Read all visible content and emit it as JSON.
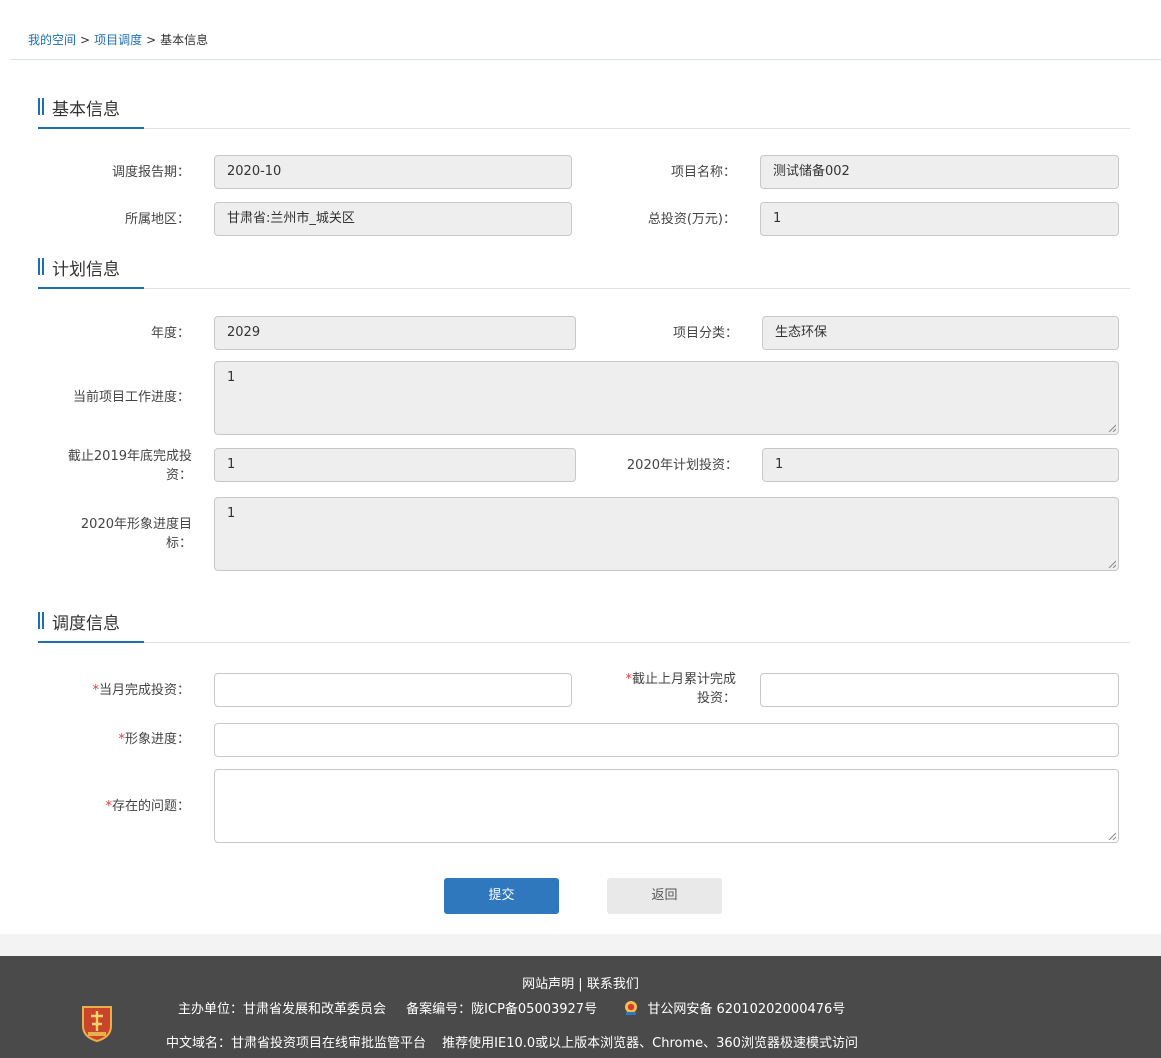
{
  "breadcrumb": {
    "items": [
      "我的空间",
      "项目调度",
      "基本信息"
    ],
    "sep": ">"
  },
  "sections": {
    "basic": "基本信息",
    "plan": "计划信息",
    "dispatch": "调度信息"
  },
  "basic": {
    "report_period": {
      "label": "调度报告期：",
      "value": "2020-10"
    },
    "project_name": {
      "label": "项目名称：",
      "value": "测试储备002"
    },
    "region": {
      "label": "所属地区：",
      "value": "甘肃省:兰州市_城关区"
    },
    "total_investment": {
      "label": "总投资(万元)：",
      "value": "1"
    }
  },
  "plan": {
    "year": {
      "label": "年度：",
      "value": "2029"
    },
    "category": {
      "label": "项目分类：",
      "value": "生态环保"
    },
    "progress": {
      "label": "当前项目工作进度：",
      "value": "1"
    },
    "completed_2019": {
      "label_line1": "截止2019年底完成投",
      "label_line2": "资：",
      "value": "1"
    },
    "planned_2020": {
      "label": "2020年计划投资：",
      "value": "1"
    },
    "target_2020": {
      "label_line1": "2020年形象进度目",
      "label_line2": "标：",
      "value": "1"
    }
  },
  "dispatch": {
    "required_mark": "*",
    "monthly_investment": {
      "label": "当月完成投资：",
      "value": ""
    },
    "cumulative_investment": {
      "label_line1": "截止上月累计完成",
      "label_line2": "投资：",
      "value": ""
    },
    "image_progress": {
      "label": "形象进度：",
      "value": ""
    },
    "issues": {
      "label": "存在的问题：",
      "value": ""
    }
  },
  "buttons": {
    "submit": "提交",
    "back": "返回"
  },
  "footer": {
    "links": "网站声明 | 联系我们",
    "sponsor": "主办单位：甘肃省发展和改革委员会",
    "icp": "备案编号：陇ICP备05003927号",
    "police": "甘公网安备 62010202000476号",
    "domain": "中文域名：甘肃省投资项目在线审批监管平台",
    "browser": "推荐使用IE10.0或以上版本浏览器、Chrome、360浏览器极速模式访问"
  },
  "colors": {
    "accent": "#1f6fb2",
    "primary_button": "#2f78bd",
    "required": "#e4393c",
    "footer_bg": "#4a4a4a"
  }
}
